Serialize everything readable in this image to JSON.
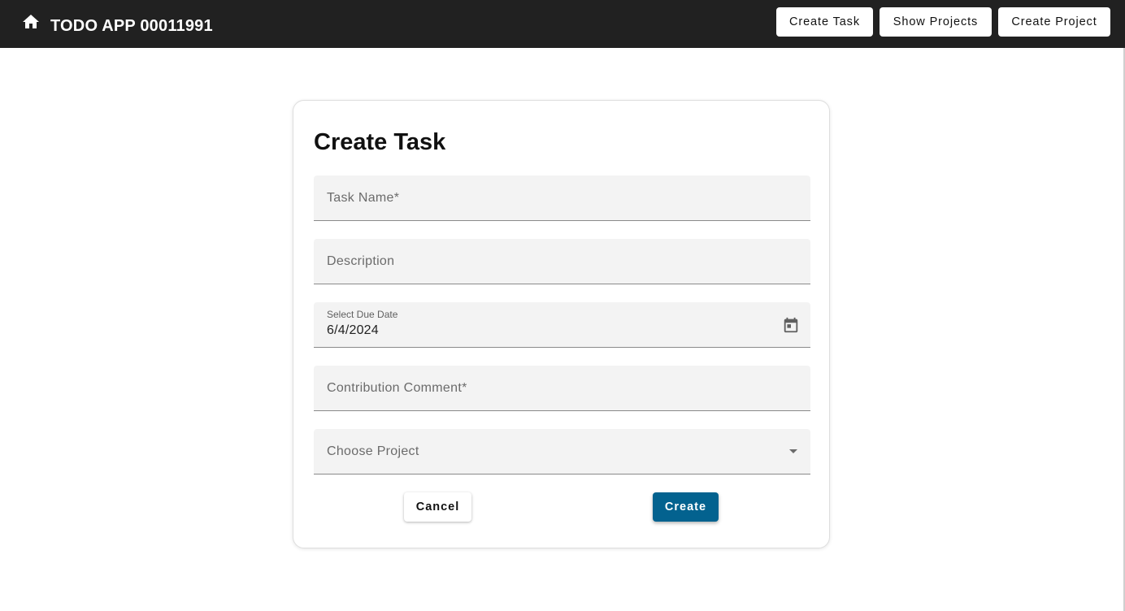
{
  "app": {
    "title": "TODO APP 00011991",
    "home_icon": "home-icon"
  },
  "nav": {
    "create_task": "Create Task",
    "show_projects": "Show Projects",
    "create_project": "Create Project"
  },
  "form": {
    "title": "Create Task",
    "task_name_label": "Task Name*",
    "description_label": "Description",
    "due_date_label": "Select Due Date",
    "due_date_value": "6/4/2024",
    "calendar_icon": "calendar-icon",
    "contribution_label": "Contribution Comment*",
    "project_label": "Choose Project",
    "cancel_label": "Cancel",
    "create_label": "Create"
  },
  "colors": {
    "appbar": "#212121",
    "primary_button": "#03628f",
    "field_background": "#f3f3f3"
  }
}
